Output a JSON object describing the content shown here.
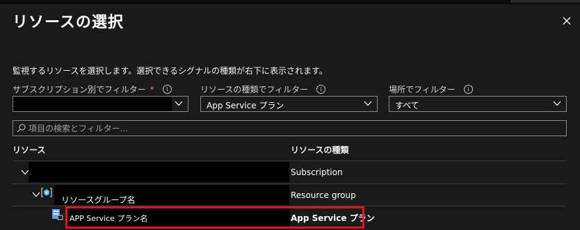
{
  "panel": {
    "title": "リソースの選択",
    "description": "監視するリソースを選択します。選択できるシグナルの種類が右下に表示されます。"
  },
  "filters": {
    "subscription": {
      "label": "サブスクリプション別でフィルター",
      "required_mark": "*",
      "value": ""
    },
    "resource_type": {
      "label": "リソースの種類でフィルター",
      "value": "App Service プラン"
    },
    "location": {
      "label": "場所でフィルター",
      "value": "すべて"
    }
  },
  "search": {
    "placeholder": "項目の検索とフィルター..."
  },
  "table": {
    "headers": {
      "resource": "リソース",
      "type": "リソースの種類"
    },
    "rows": [
      {
        "name": "",
        "type": "Subscription",
        "expand": "chevron-down-icon"
      },
      {
        "name": "リソースグループ名",
        "type": "Resource group",
        "icon": "resource-group-icon"
      },
      {
        "name": "APP Service プラン名",
        "type": "App Service プラン",
        "icon": "app-service-plan-icon",
        "highlighted": true
      }
    ]
  },
  "colors": {
    "background": "#1b1a19",
    "border": "#8a8886",
    "highlight": "#e81123",
    "accent": "#0078d4",
    "required": "#f1707b"
  }
}
